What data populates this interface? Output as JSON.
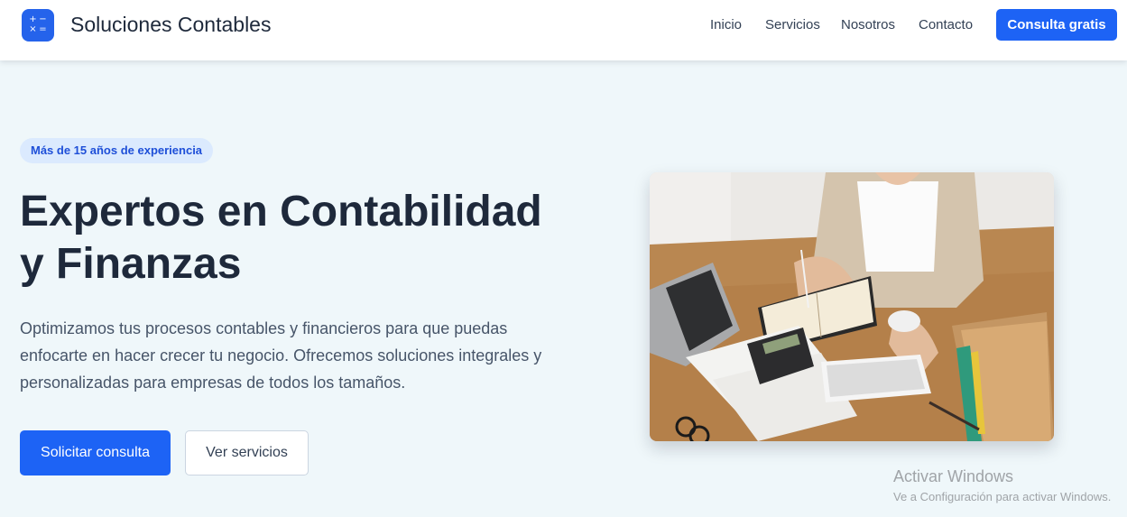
{
  "header": {
    "brand_name": "Soluciones Contables",
    "brand_icon": "calculator-icon",
    "nav": {
      "inicio": "Inicio",
      "servicios": "Servicios",
      "nosotros": "Nosotros",
      "contacto": "Contacto"
    },
    "cta_label": "Consulta gratis"
  },
  "hero": {
    "badge": "Más de 15 años de experiencia",
    "title_line1": "Expertos en Contabilidad",
    "title_line2": "y Finanzas",
    "description": "Optimizamos tus procesos contables y financieros para que puedas enfocarte en hacer crecer tu negocio. Ofrecemos soluciones integrales y personalizadas para empresas de todos los tamaños.",
    "primary_button": "Solicitar consulta",
    "secondary_button": "Ver servicios",
    "image_icon": "accountant-desk-photo"
  },
  "watermark": {
    "title": "Activar Windows",
    "subtitle": "Ve a Configuración para activar Windows."
  },
  "colors": {
    "accent": "#1d63f5",
    "page_background": "#eff7fa",
    "badge_background": "#dbeafe",
    "heading": "#1e293b"
  }
}
